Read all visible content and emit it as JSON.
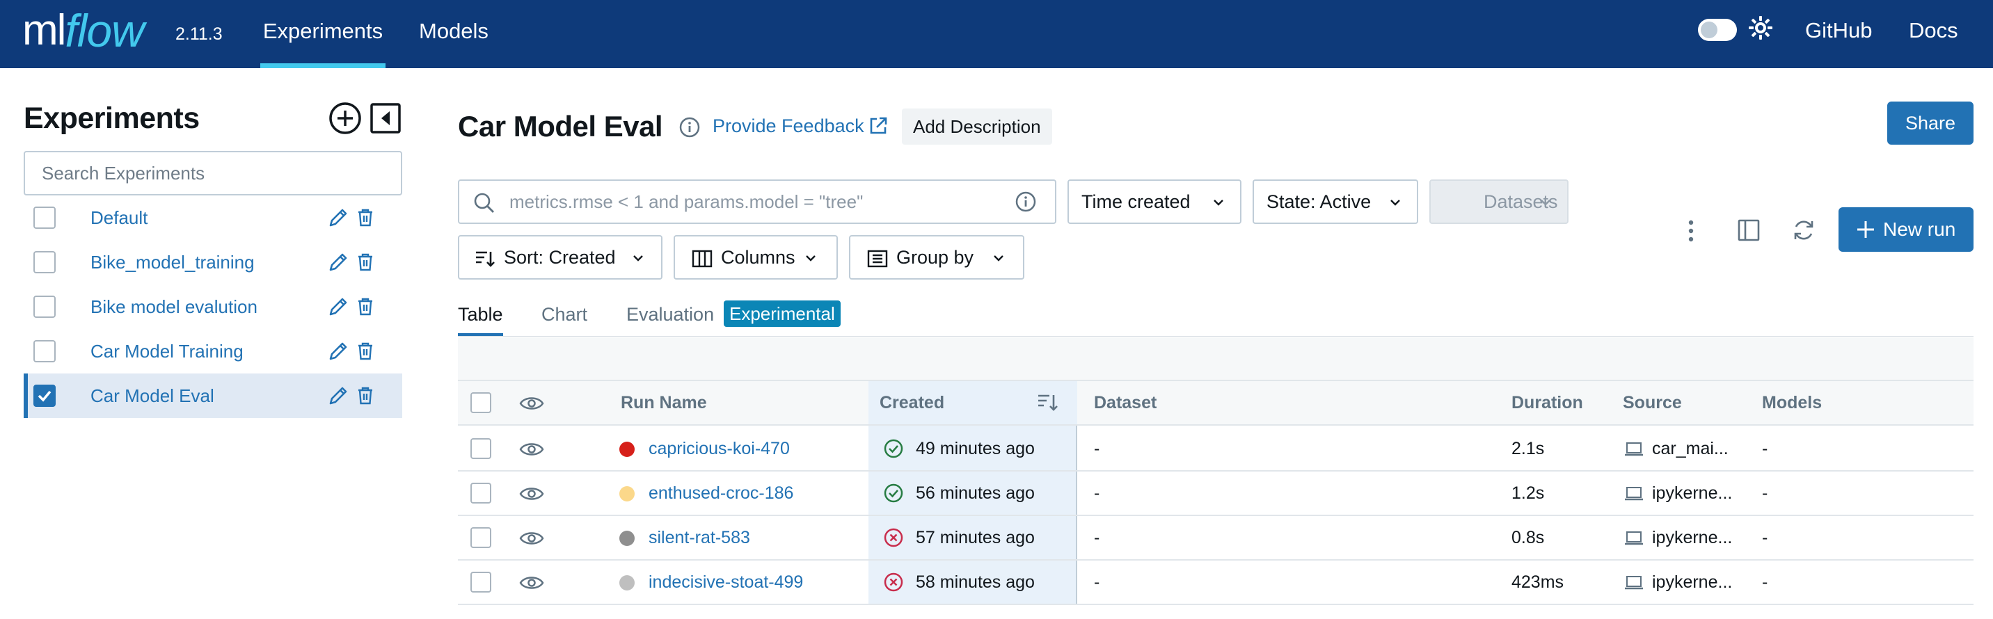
{
  "app": {
    "logo_ml": "ml",
    "logo_flow": "flow",
    "version": "2.11.3",
    "nav": [
      "Experiments",
      "Models"
    ],
    "links": [
      "GitHub",
      "Docs"
    ],
    "brand_color": "#0e3a7a",
    "accent_color": "#43c9ed"
  },
  "sidebar": {
    "title": "Experiments",
    "search_placeholder": "Search Experiments",
    "experiments": [
      {
        "name": "Default",
        "checked": false
      },
      {
        "name": "Bike_model_training",
        "checked": false
      },
      {
        "name": "Bike model evalution",
        "checked": false
      },
      {
        "name": "Car Model Training",
        "checked": false
      },
      {
        "name": "Car Model Eval",
        "checked": true
      }
    ],
    "icons": [
      "add-circle-icon",
      "collapse-sidebar-icon",
      "pencil-icon",
      "trash-icon"
    ]
  },
  "main": {
    "title": "Car Model Eval",
    "feedback_label": "Provide Feedback",
    "add_description_label": "Add Description",
    "share_label": "Share",
    "search_placeholder": "metrics.rmse < 1 and params.model = \"tree\"",
    "filters": {
      "time": "Time created",
      "state": "State: Active",
      "datasets": "Datasets",
      "sort": "Sort: Created",
      "columns": "Columns",
      "group": "Group by"
    },
    "new_run_label": "New run",
    "tabs": [
      "Table",
      "Chart",
      "Evaluation"
    ],
    "experimental_badge": "Experimental",
    "table": {
      "headers": [
        "Run Name",
        "Created",
        "Dataset",
        "Duration",
        "Source",
        "Models"
      ],
      "rows": [
        {
          "name": "capricious-koi-470",
          "color": "#d6201a",
          "status": "success",
          "created": "49 minutes ago",
          "dataset": "-",
          "duration": "2.1s",
          "source": "car_mai...",
          "models": "-"
        },
        {
          "name": "enthused-croc-186",
          "color": "#fbd88a",
          "status": "success",
          "created": "56 minutes ago",
          "dataset": "-",
          "duration": "1.2s",
          "source": "ipykerne...",
          "models": "-"
        },
        {
          "name": "silent-rat-583",
          "color": "#8f8f8f",
          "status": "failed",
          "created": "57 minutes ago",
          "dataset": "-",
          "duration": "0.8s",
          "source": "ipykerne...",
          "models": "-"
        },
        {
          "name": "indecisive-stoat-499",
          "color": "#bfbfbf",
          "status": "failed",
          "created": "58 minutes ago",
          "dataset": "-",
          "duration": "423ms",
          "source": "ipykerne...",
          "models": "-"
        }
      ]
    }
  }
}
